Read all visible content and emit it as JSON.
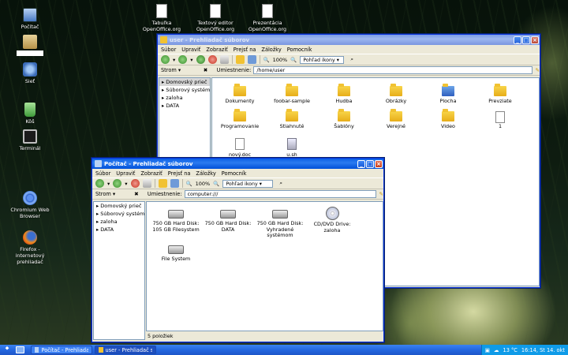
{
  "desktop": {
    "icons": [
      {
        "label": "Počítač",
        "icon": "computer-icon"
      },
      {
        "label": "",
        "icon": "user-home-icon"
      },
      {
        "label": "Sieť",
        "icon": "network-icon"
      },
      {
        "label": "Kôš",
        "icon": "trash-icon"
      },
      {
        "label": "Terminál",
        "icon": "terminal-icon"
      },
      {
        "label": "Chromium Web Browser",
        "icon": "chromium-icon"
      },
      {
        "label": "Firefox - internetový prehliadač",
        "icon": "firefox-icon"
      }
    ],
    "top_icons": [
      {
        "label": "Tabuľka OpenOffice.org",
        "icon": "spreadsheet-icon"
      },
      {
        "label": "Textový editor OpenOffice.org",
        "icon": "text-document-icon"
      },
      {
        "label": "Prezentácia OpenOffice.org",
        "icon": "presentation-icon"
      }
    ]
  },
  "win_user": {
    "title": "user - Prehliadač súborov",
    "menu": [
      "Súbor",
      "Upraviť",
      "Zobraziť",
      "Prejsť na",
      "Záložky",
      "Pomocník"
    ],
    "zoom": "100%",
    "view_mode": "Pohľad ikony",
    "sidebar_mode": "Strom",
    "location_label": "Umiestnenie:",
    "location_value": "/home/user",
    "tree": [
      "Domovský prieč",
      "Súborový systém",
      "zaloha",
      "DATA"
    ],
    "files": [
      "Dokumenty",
      "foobar-sample",
      "Hudba",
      "Obrázky",
      "Plocha",
      "Prevziate",
      "Programovanie",
      "Stiahnuté",
      "Šablóny",
      "Verejné",
      "Video",
      "1",
      "nový.doc",
      "u.sh"
    ]
  },
  "win_computer": {
    "title": "Počítač - Prehliadač súborov",
    "menu": [
      "Súbor",
      "Upraviť",
      "Zobraziť",
      "Prejsť na",
      "Záložky",
      "Pomocník"
    ],
    "zoom": "100%",
    "view_mode": "Pohľad ikony",
    "sidebar_mode": "Strom",
    "location_label": "Umiestnenie:",
    "location_value": "computer:///",
    "tree": [
      "Domovský prieč",
      "Súborový systém",
      "zaloha",
      "DATA"
    ],
    "drives": [
      "750 GB Hard Disk: 105 GB Filesystem",
      "750 GB Hard Disk: DATA",
      "750 GB Hard Disk: Vyhradené systémom",
      "CD/DVD Drive: zaloha",
      "File System"
    ],
    "status": "5 položiek"
  },
  "taskbar": {
    "tasks": [
      "Počítač - Prehliadač s...",
      "user - Prehliadač súb..."
    ],
    "temperature": "13 °C",
    "clock": "16:14, St 14. okt"
  },
  "colors": {
    "titlebar": "#0a5fe5",
    "taskbar": "#2467e0",
    "folder": "#f1c232"
  }
}
